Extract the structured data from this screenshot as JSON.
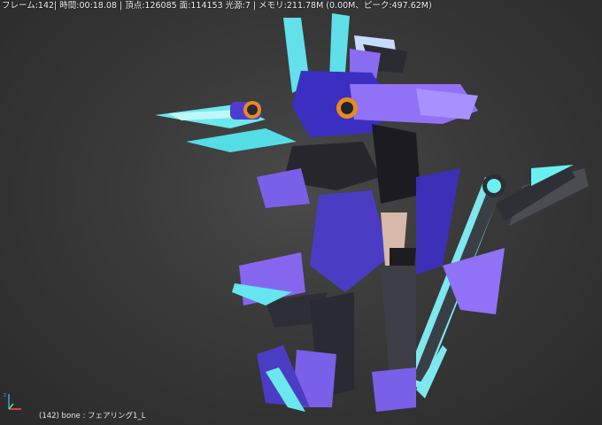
{
  "viewport": {
    "stats": "フレーム:142| 時間:00:18.08 | 頂点:126085 面:114153 光源:7 | メモリ:211.78M (0.00M、ピーク:497.62M)",
    "status": "(142) bone : フェアリング1_L",
    "model_icon": "mecha-robot-model",
    "axis_icon": "xyz-axis-gizmo-icon"
  },
  "colors": {
    "background": "#3a3a3a",
    "armor_purple": "#8a6cf0",
    "armor_dark_purple": "#3a2fb8",
    "accent_cyan": "#5ef2f2",
    "frame_black": "#1e1e22",
    "frame_grey": "#4a4a50"
  }
}
